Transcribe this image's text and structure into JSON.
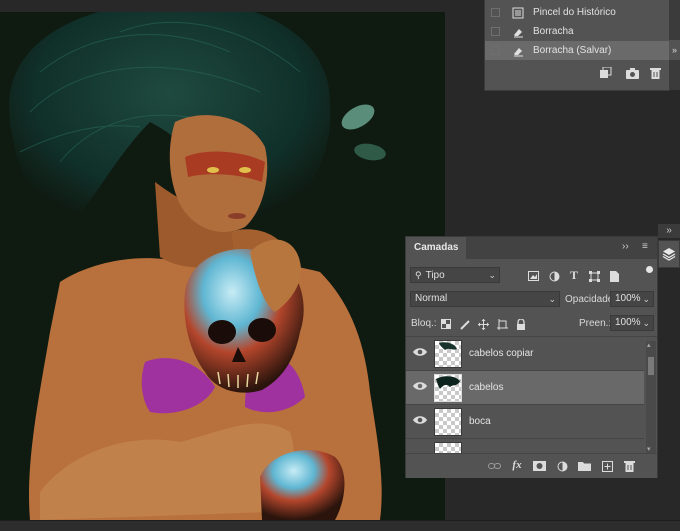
{
  "history": {
    "items": [
      {
        "label": "Pincel do Histórico",
        "icon": "history-brush-icon",
        "selected": false
      },
      {
        "label": "Borracha",
        "icon": "eraser-icon",
        "selected": false
      },
      {
        "label": "Borracha (Salvar)",
        "icon": "eraser-icon",
        "selected": true
      }
    ],
    "footer_icons": [
      "new-document-from-state-icon",
      "camera-snapshot-icon",
      "trash-icon"
    ]
  },
  "layers": {
    "tab_label": "Camadas",
    "filter_label": "Tipo",
    "blend_mode": "Normal",
    "opacity_label": "Opacidade:",
    "opacity_value": "100%",
    "lock_label": "Bloq.:",
    "fill_label": "Preen.:",
    "fill_value": "100%",
    "rows": [
      {
        "name": "cabelos copiar",
        "visible": true,
        "selected": false
      },
      {
        "name": "cabelos",
        "visible": true,
        "selected": true
      },
      {
        "name": "boca",
        "visible": true,
        "selected": false
      }
    ],
    "footer_icons": [
      "link-icon",
      "fx-icon",
      "mask-icon",
      "adjustment-icon",
      "folder-icon",
      "new-layer-icon",
      "trash-icon"
    ]
  },
  "colors": {
    "panel": "#535353",
    "canvas_bg": "#0f1a11",
    "selection": "#696969"
  }
}
